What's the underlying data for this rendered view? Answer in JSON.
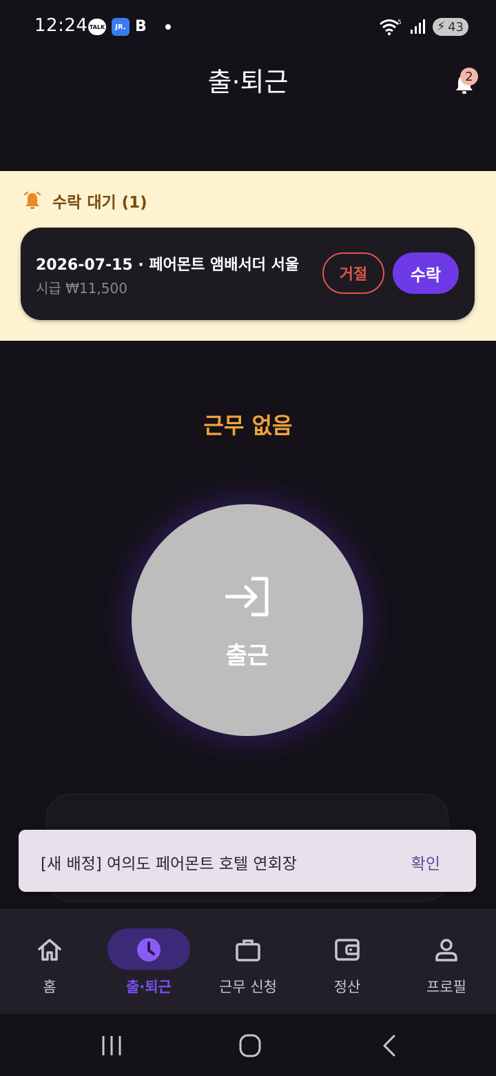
{
  "status_bar": {
    "time": "12:24",
    "talk_label": "TALK",
    "jr_label": "JR.",
    "b_label": "B",
    "battery": "43",
    "signal_label": "5"
  },
  "header": {
    "title": "출·퇴근",
    "notification_count": "2"
  },
  "pending": {
    "title": "수락 대기 (1)",
    "card": {
      "title": "2026-07-15 · 페어몬트 앰배서더 서울",
      "wage": "시급 ₩11,500",
      "reject_label": "거절",
      "accept_label": "수락"
    }
  },
  "main": {
    "work_status": "근무 없음",
    "clock_in_label": "출근"
  },
  "snackbar": {
    "message": "[새 배정] 여의도 페어몬트 호텔 연회장",
    "action": "확인"
  },
  "nav": {
    "items": [
      {
        "label": "홈",
        "icon": "home-icon"
      },
      {
        "label": "출·퇴근",
        "icon": "clock-icon"
      },
      {
        "label": "근무 신청",
        "icon": "briefcase-icon"
      },
      {
        "label": "정산",
        "icon": "wallet-icon"
      },
      {
        "label": "프로필",
        "icon": "person-icon"
      }
    ],
    "active_index": 1
  },
  "colors": {
    "background": "#141118",
    "accent": "#6d3ae6",
    "warning": "#f0a23c",
    "banner": "#fdf3d0",
    "reject": "#e0564e"
  }
}
